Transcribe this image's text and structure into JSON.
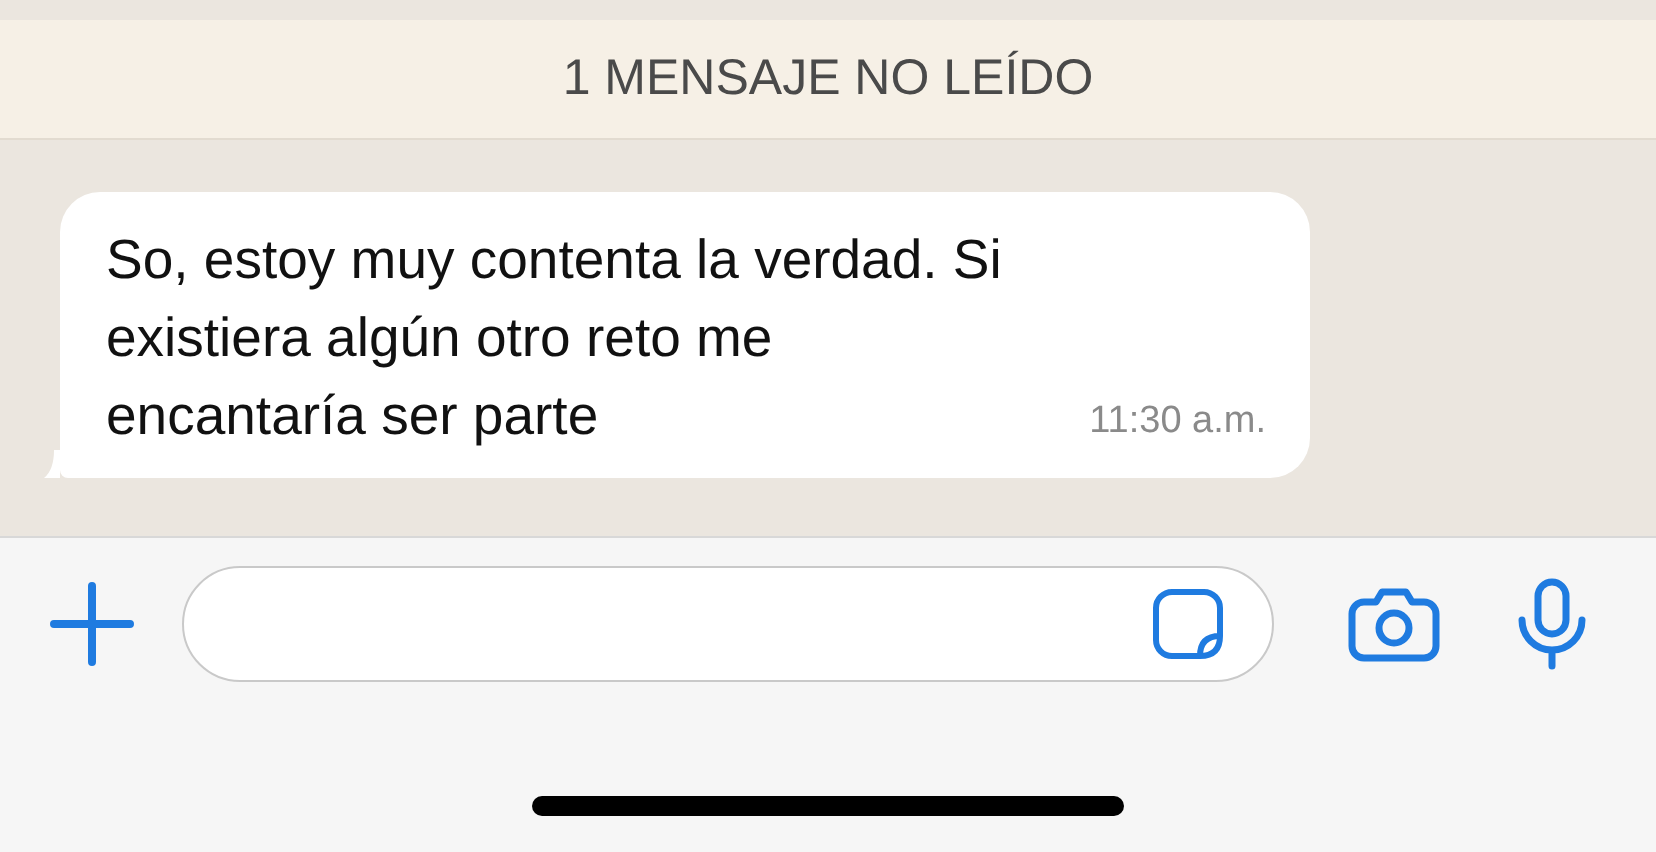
{
  "unread_banner": {
    "label": "1 MENSAJE NO LEÍDO"
  },
  "messages": [
    {
      "text": "So, estoy muy contenta la verdad. Si existiera algún otro reto me encantaría ser parte",
      "time": "11:30 a.m.",
      "incoming": true
    }
  ]
}
